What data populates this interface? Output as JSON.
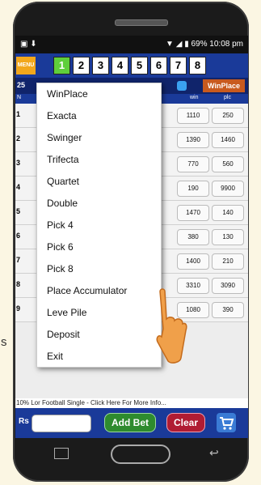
{
  "status_bar": {
    "battery": "69%",
    "time": "10:08 pm"
  },
  "menu_button_label": "MENU",
  "race_numbers": [
    "1",
    "2",
    "3",
    "4",
    "5",
    "6",
    "7",
    "8"
  ],
  "active_race": "1",
  "subbar": {
    "left_text": "25",
    "winplace_tab": "WinPlace"
  },
  "table_headers": {
    "no": "N",
    "win": "win",
    "plc": "plc"
  },
  "rows": [
    {
      "num": "1",
      "win": "1110",
      "plc": "250"
    },
    {
      "num": "2",
      "win": "1390",
      "plc": "1460"
    },
    {
      "num": "3",
      "win": "770",
      "plc": "560"
    },
    {
      "num": "4",
      "win": "190",
      "plc": "9900"
    },
    {
      "num": "5",
      "win": "1470",
      "plc": "140"
    },
    {
      "num": "6",
      "win": "380",
      "plc": "130"
    },
    {
      "num": "7",
      "win": "1400",
      "plc": "210"
    },
    {
      "num": "8",
      "win": "3310",
      "plc": "3090"
    },
    {
      "num": "9",
      "win": "1080",
      "plc": "390"
    }
  ],
  "dropdown_items": [
    "WinPlace",
    "Exacta",
    "Swinger",
    "Trifecta",
    "Quartet",
    "Double",
    "Pick 4",
    "Pick 6",
    "Pick 8",
    "Place Accumulator",
    "Leve Pile",
    "Deposit",
    "Exit"
  ],
  "ticker_text": "10% Lor Football Single - Click Here For More Info...",
  "bottom": {
    "rs_label": "Rs",
    "amount_value": "",
    "add_bet": "Add Bet",
    "clear": "Clear"
  },
  "side_text": "s"
}
